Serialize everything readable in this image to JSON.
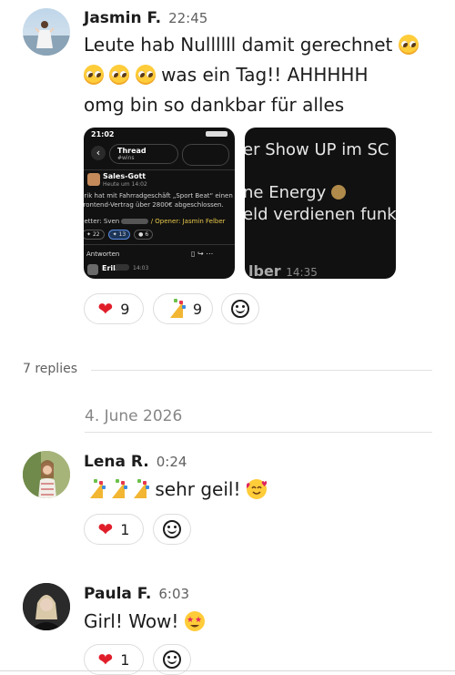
{
  "messages": [
    {
      "author": "Jasmin F.",
      "time": "22:45",
      "lines": [
        "Leute hab Nullllll damit gerechnet",
        "was ein Tag!! AHHHHH",
        "omg bin so dankbar für alles"
      ],
      "reactions": [
        {
          "icon": "heart-emoji",
          "count": "9"
        },
        {
          "icon": "party-popper-emoji",
          "count": "9"
        }
      ],
      "attachments": [
        {
          "status_time": "21:02",
          "header_title": "Thread",
          "header_subtitle": "#wins",
          "post_author": "Sales-Gott",
          "post_time": "Heute um 14:02",
          "post_text_1": "Erik hat mit Fahrradgeschäft „Sport Beat“ einen",
          "post_text_2": "Frontend-Vertrag über 2800€ abgeschlossen.",
          "setter_label": "Setter: Sven",
          "opener_label": "/ Opener: Jasmin Felber",
          "r1": "22",
          "r2": "13",
          "r3": "6",
          "replies_label": "Antworten",
          "reply_author": "Erik",
          "reply_time": "14:03"
        },
        {
          "line1": "er Show UP im SC",
          "line2": "ne Energy",
          "line3": "eld verdienen funkt",
          "line4": "lber",
          "line4_time": "14:35"
        }
      ]
    },
    {
      "author": "Lena R.",
      "time": "0:24",
      "text": "sehr geil!",
      "reactions": [
        {
          "icon": "heart-emoji",
          "count": "1"
        }
      ]
    },
    {
      "author": "Paula F.",
      "time": "6:03",
      "text": "Girl! Wow!",
      "reactions": [
        {
          "icon": "heart-emoji",
          "count": "1"
        }
      ]
    }
  ],
  "replies_count": "7 replies",
  "date_divider": "4. June 2026",
  "colors": {
    "heart": "#e01e2a",
    "text": "#1d1c1d",
    "muted": "#616061",
    "border": "#dddddd"
  }
}
